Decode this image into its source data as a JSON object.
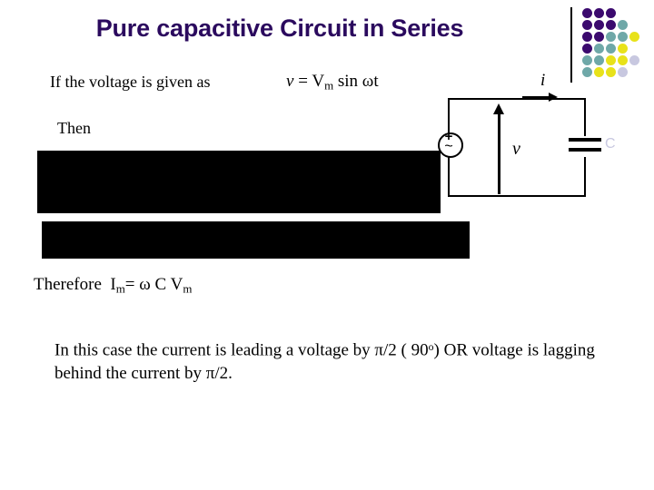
{
  "slide": {
    "title": "Pure capacitive Circuit in Series",
    "title_color": "#2b0a5e",
    "background_color": "#ffffff"
  },
  "content": {
    "intro_text": "If the voltage is given as",
    "formula_voltage": {
      "variable": "v",
      "equals": "=",
      "amplitude": "V",
      "amplitude_sub": "m",
      "function": "sin",
      "omega": "ω",
      "time": "t"
    },
    "then_label": "Then",
    "therefore_label": "Therefore",
    "formula_current": {
      "variable": "I",
      "variable_sub": "m",
      "equals": "=",
      "omega": "ω",
      "capacitance": "C",
      "amplitude": "V",
      "amplitude_sub": "m"
    },
    "conclusion_line1": "In this case the current is leading a voltage by π/2 ( 90",
    "conclusion_line1_sup": "o",
    "conclusion_line1_end": ") OR",
    "conclusion_line2": "voltage is lagging behind the current by π/2."
  },
  "redactions": [
    {
      "name": "hidden-derivation-line-1"
    },
    {
      "name": "hidden-derivation-line-2"
    }
  ],
  "circuit": {
    "source_plus": "+",
    "source_tilde": "~",
    "label_current": "i",
    "label_voltage": "v",
    "label_capacitor": "C",
    "capacitor_label_color": "#c8c8e0"
  },
  "decoration": {
    "colors": {
      "purple": "#3b0a6e",
      "teal": "#6fa8a8",
      "yellow": "#e8e21a",
      "lavender": "#c8c8e0"
    },
    "grid": [
      [
        "purple",
        "purple",
        "purple",
        null,
        null
      ],
      [
        "purple",
        "purple",
        "purple",
        "teal",
        null
      ],
      [
        "purple",
        "purple",
        "teal",
        "teal",
        "yellow"
      ],
      [
        "purple",
        "teal",
        "teal",
        "yellow",
        null
      ],
      [
        "teal",
        "teal",
        "yellow",
        "yellow",
        "lavender"
      ],
      [
        "teal",
        "yellow",
        "yellow",
        "lavender",
        null
      ]
    ]
  }
}
